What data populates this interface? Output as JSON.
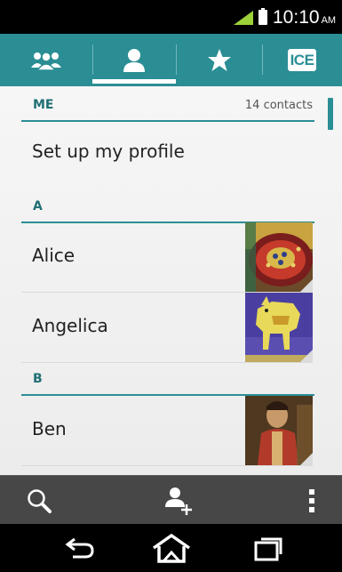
{
  "status_bar": {
    "time": "10:10",
    "ampm": "AM"
  },
  "tabs": [
    {
      "name": "groups",
      "icon": "groups-icon"
    },
    {
      "name": "contacts",
      "icon": "person-icon",
      "selected": true
    },
    {
      "name": "favorites",
      "icon": "star-icon"
    },
    {
      "name": "ice",
      "label": "ICE"
    }
  ],
  "list": {
    "me_header": "ME",
    "contact_count": "14 contacts",
    "profile_label": "Set up my profile",
    "sections": [
      {
        "letter": "A",
        "contacts": [
          {
            "name": "Alice"
          },
          {
            "name": "Angelica"
          }
        ]
      },
      {
        "letter": "B",
        "contacts": [
          {
            "name": "Ben"
          }
        ]
      }
    ]
  },
  "action_bar": [
    "search-icon",
    "add-contact-icon",
    "overflow-menu-icon"
  ],
  "nav_bar": [
    "back-icon",
    "home-icon",
    "recent-apps-icon"
  ],
  "colors": {
    "accent": "#2a8e94",
    "action_bar": "#474747"
  }
}
